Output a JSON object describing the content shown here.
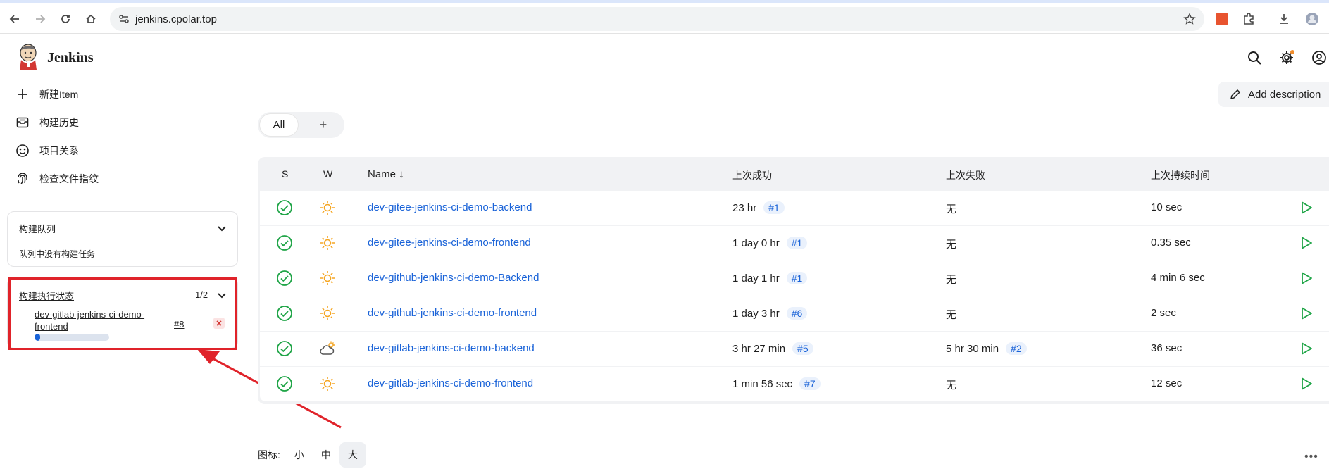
{
  "browser": {
    "url": "jenkins.cpolar.top"
  },
  "app": {
    "title": "Jenkins"
  },
  "sidebar": {
    "items": [
      {
        "label": "新建Item",
        "icon": "plus-icon"
      },
      {
        "label": "构建历史",
        "icon": "history-icon"
      },
      {
        "label": "项目关系",
        "icon": "relationship-icon"
      },
      {
        "label": "检查文件指纹",
        "icon": "fingerprint-icon"
      }
    ],
    "build_queue": {
      "title": "构建队列",
      "empty_text": "队列中没有构建任务"
    },
    "executors": {
      "title": "构建执行状态",
      "count": "1/2",
      "running_job": "dev-gitlab-jenkins-ci-demo-frontend",
      "running_build": "#8",
      "progress": 0.08
    }
  },
  "main": {
    "add_description_label": "Add description",
    "tabs": {
      "all": "All",
      "add": "+"
    },
    "table": {
      "headers": {
        "s": "S",
        "w": "W",
        "name": "Name ↓",
        "last_success": "上次成功",
        "last_failure": "上次失败",
        "last_duration": "上次持续时间"
      },
      "rows": [
        {
          "name": "dev-gitee-jenkins-ci-demo-backend",
          "weather": "sunny",
          "last_success": "23 hr",
          "success_build": "#1",
          "last_failure": "无",
          "failure_build": "",
          "duration": "10 sec"
        },
        {
          "name": "dev-gitee-jenkins-ci-demo-frontend",
          "weather": "sunny",
          "last_success": "1 day 0 hr",
          "success_build": "#1",
          "last_failure": "无",
          "failure_build": "",
          "duration": "0.35 sec"
        },
        {
          "name": "dev-github-jenkins-ci-demo-Backend",
          "weather": "sunny",
          "last_success": "1 day 1 hr",
          "success_build": "#1",
          "last_failure": "无",
          "failure_build": "",
          "duration": "4 min 6 sec"
        },
        {
          "name": "dev-github-jenkins-ci-demo-frontend",
          "weather": "sunny",
          "last_success": "1 day 3 hr",
          "success_build": "#6",
          "last_failure": "无",
          "failure_build": "",
          "duration": "2 sec"
        },
        {
          "name": "dev-gitlab-jenkins-ci-demo-backend",
          "weather": "cloudy",
          "last_success": "3 hr 27 min",
          "success_build": "#5",
          "last_failure": "5 hr 30 min",
          "failure_build": "#2",
          "duration": "36 sec"
        },
        {
          "name": "dev-gitlab-jenkins-ci-demo-frontend",
          "weather": "sunny",
          "last_success": "1 min 56 sec",
          "success_build": "#7",
          "last_failure": "无",
          "failure_build": "",
          "duration": "12 sec"
        }
      ]
    },
    "icon_size": {
      "label": "图标:",
      "small": "小",
      "medium": "中",
      "large": "大",
      "selected": "大"
    }
  },
  "colors": {
    "accent": "#1a63d8",
    "success": "#1ea446",
    "sun": "#f5a623",
    "annotation": "#e0232a"
  }
}
